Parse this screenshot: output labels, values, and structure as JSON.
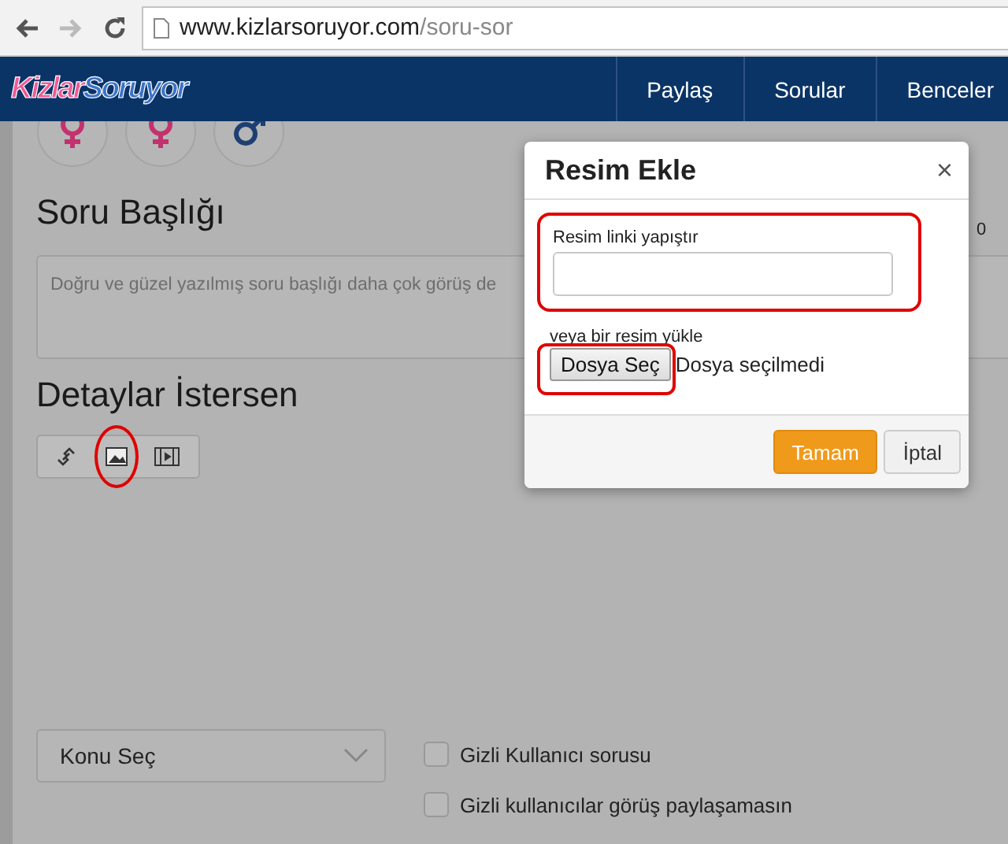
{
  "browser": {
    "host": "www.kizlarsoruyor.com",
    "path": "/soru-sor",
    "forward_disabled": true
  },
  "header": {
    "logo": {
      "first": "Kizlar",
      "second": "Soruyor"
    },
    "nav": [
      "Paylaş",
      "Sorular",
      "Benceler"
    ]
  },
  "gender_options": [
    {
      "kind": "female",
      "color": "#c2326e"
    },
    {
      "kind": "female",
      "color": "#c2326e"
    },
    {
      "kind": "male",
      "color": "#1d3f73"
    }
  ],
  "title_section": {
    "heading": "Soru Başlığı",
    "placeholder": "Doğru ve güzel yazılmış soru başlığı daha çok görüş de",
    "counter": "0"
  },
  "details_section": {
    "heading": "Detaylar İstersen",
    "tools": [
      {
        "kind": "link",
        "highlighted": false
      },
      {
        "kind": "image",
        "highlighted": true
      },
      {
        "kind": "video",
        "highlighted": false
      }
    ]
  },
  "topic_select": {
    "value": "Konu Seç"
  },
  "options": [
    {
      "label": "Gizli Kullanıcı sorusu",
      "checked": false
    },
    {
      "label": "Gizli kullanıcılar görüş paylaşamasın",
      "checked": false
    }
  ],
  "dialog": {
    "title": "Resim Ekle",
    "close": "×",
    "link_label": "Resim linki yapıştır",
    "link_highlighted": true,
    "upload_label": "veya bir resim yükle",
    "file_button": "Dosya Seç",
    "file_highlighted": true,
    "file_status": "Dosya seçilmedi",
    "buttons": [
      {
        "label": "Tamam",
        "kind": "primary"
      },
      {
        "label": "İptal",
        "kind": "default"
      }
    ]
  }
}
